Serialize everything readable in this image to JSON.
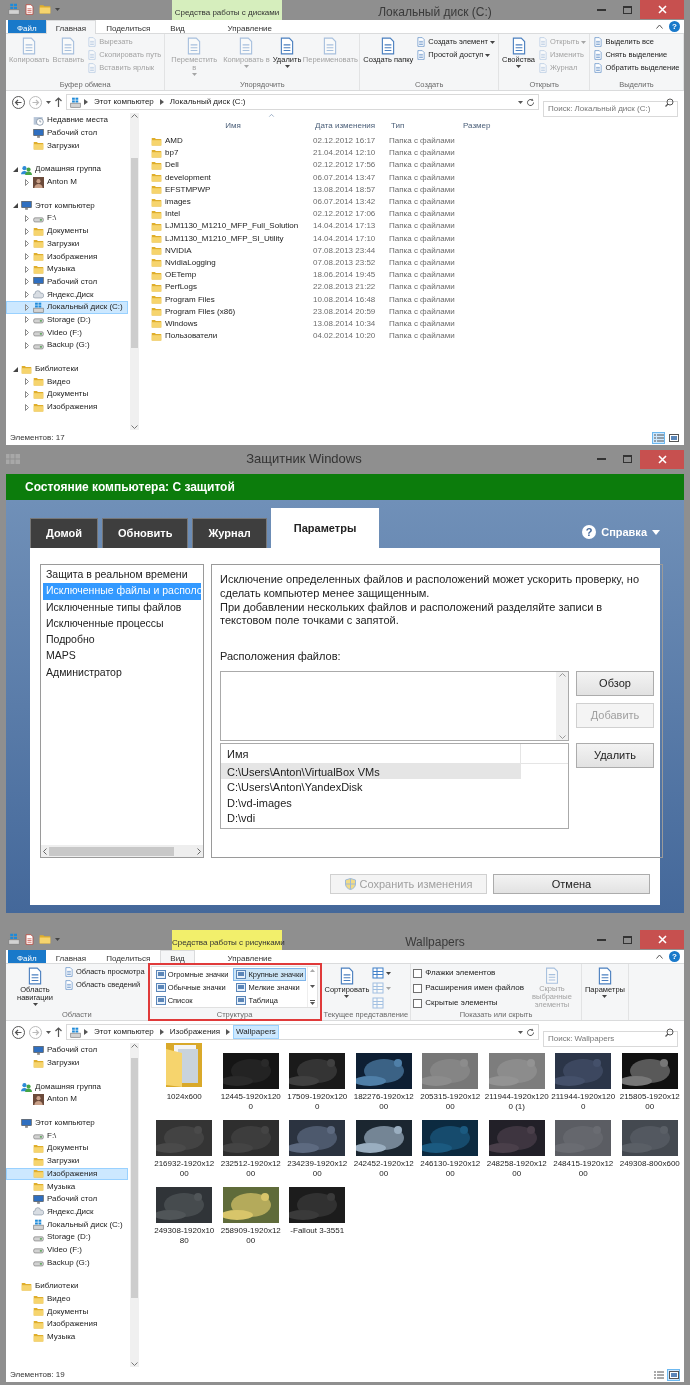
{
  "explorer_disk": {
    "title": "Локальный диск (C:)",
    "contextual": {
      "label": "Средства работы с дисками",
      "kind": "disk"
    },
    "help_icon": "?",
    "tabs": [
      {
        "label": "Файл",
        "kind": "file",
        "selected": false
      },
      {
        "label": "Главная",
        "kind": "tab",
        "selected": true
      },
      {
        "label": "Поделиться",
        "kind": "tab",
        "selected": false
      },
      {
        "label": "Вид",
        "kind": "tab",
        "selected": false
      },
      {
        "label": "Управление",
        "kind": "contextual",
        "selected": false
      }
    ],
    "ribbon_groups": [
      {
        "label": "Буфер обмена",
        "items": [
          {
            "label": "Копировать",
            "kind": "large",
            "disabled": true,
            "dropdown": false
          },
          {
            "label": "Вставить",
            "kind": "large",
            "disabled": true,
            "dropdown": false
          },
          {
            "label": "Вырезать",
            "kind": "small",
            "disabled": true,
            "dropdown": false
          },
          {
            "label": "Скопировать путь",
            "kind": "small",
            "disabled": true,
            "dropdown": false
          },
          {
            "label": "Вставить ярлык",
            "kind": "small",
            "disabled": true,
            "dropdown": false
          }
        ]
      },
      {
        "label": "Упорядочить",
        "items": [
          {
            "label": "Переместить в",
            "kind": "large",
            "disabled": true,
            "dropdown": true
          },
          {
            "label": "Копировать в",
            "kind": "large",
            "disabled": true,
            "dropdown": true
          },
          {
            "label": "Удалить",
            "kind": "large",
            "disabled": false,
            "dropdown": true
          },
          {
            "label": "Переименовать",
            "kind": "large",
            "disabled": true,
            "dropdown": false
          }
        ]
      },
      {
        "label": "Создать",
        "items": [
          {
            "label": "Создать папку",
            "kind": "large",
            "disabled": false,
            "dropdown": false
          },
          {
            "label": "Создать элемент",
            "kind": "small",
            "disabled": false,
            "dropdown": true
          },
          {
            "label": "Простой доступ",
            "kind": "small",
            "disabled": false,
            "dropdown": true
          }
        ]
      },
      {
        "label": "Открыть",
        "items": [
          {
            "label": "Свойства",
            "kind": "large",
            "disabled": false,
            "dropdown": true
          },
          {
            "label": "Открыть",
            "kind": "small",
            "disabled": true,
            "dropdown": true
          },
          {
            "label": "Изменить",
            "kind": "small",
            "disabled": true,
            "dropdown": false
          },
          {
            "label": "Журнал",
            "kind": "small",
            "disabled": true,
            "dropdown": false
          }
        ]
      },
      {
        "label": "Выделить",
        "items": [
          {
            "label": "Выделить все",
            "kind": "small",
            "disabled": false,
            "dropdown": false
          },
          {
            "label": "Снять выделение",
            "kind": "small",
            "disabled": false,
            "dropdown": false
          },
          {
            "label": "Обратить выделение",
            "kind": "small",
            "disabled": false,
            "dropdown": false
          }
        ]
      }
    ],
    "address": {
      "crumbs": [
        {
          "label": "Этот компьютер",
          "highlighted": false
        },
        {
          "label": "Локальный диск (C:)",
          "highlighted": false
        }
      ],
      "search_placeholder": "Поиск: Локальный диск (C:)"
    },
    "sidebar": [
      {
        "label": "Недавние места",
        "kind": "recent",
        "selected": false
      },
      {
        "label": "Рабочий стол",
        "kind": "desktop",
        "selected": false
      },
      {
        "label": "Загрузки",
        "kind": "folder",
        "selected": false
      },
      {
        "label": "Домашняя группа",
        "kind": "group",
        "selected": false,
        "expanded": true,
        "children": [
          {
            "label": "Anton M",
            "kind": "person",
            "selected": false,
            "expanded": false
          }
        ]
      },
      {
        "label": "Этот компьютер",
        "kind": "computer",
        "selected": false,
        "expanded": true,
        "children": [
          {
            "label": "F:\\",
            "kind": "drive",
            "selected": false,
            "expanded": false
          },
          {
            "label": "Документы",
            "kind": "folder",
            "selected": false,
            "expanded": false
          },
          {
            "label": "Загрузки",
            "kind": "folder",
            "selected": false,
            "expanded": false
          },
          {
            "label": "Изображения",
            "kind": "folder",
            "selected": false,
            "expanded": false
          },
          {
            "label": "Музыка",
            "kind": "folder",
            "selected": false,
            "expanded": false
          },
          {
            "label": "Рабочий стол",
            "kind": "desktop",
            "selected": false,
            "expanded": false
          },
          {
            "label": "Яндекс.Диск",
            "kind": "cloud",
            "selected": false,
            "expanded": false
          },
          {
            "label": "Локальный диск (C:)",
            "kind": "system",
            "selected": true,
            "expanded": false
          },
          {
            "label": "Storage (D:)",
            "kind": "drive",
            "selected": false,
            "expanded": false
          },
          {
            "label": "Video (F:)",
            "kind": "drive",
            "selected": false,
            "expanded": false
          },
          {
            "label": "Backup (G:)",
            "kind": "drive",
            "selected": false,
            "expanded": false
          }
        ]
      },
      {
        "label": "Библиотеки",
        "kind": "library",
        "selected": false,
        "expanded": true,
        "children": [
          {
            "label": "Видео",
            "kind": "folder",
            "selected": false,
            "expanded": false
          },
          {
            "label": "Документы",
            "kind": "folder",
            "selected": false,
            "expanded": false
          },
          {
            "label": "Изображения",
            "kind": "folder",
            "selected": false,
            "expanded": false
          }
        ]
      }
    ],
    "main": {
      "kind": "details",
      "columns": [
        {
          "label": "Имя",
          "sorted": true
        },
        {
          "label": "Дата изменения",
          "sorted": false
        },
        {
          "label": "Тип",
          "sorted": false
        },
        {
          "label": "Размер",
          "sorted": false
        }
      ],
      "rows": [
        {
          "name": "AMD",
          "date": "02.12.2012 16:17",
          "type": "Папка с файлами"
        },
        {
          "name": "bp7",
          "date": "21.04.2014 12:10",
          "type": "Папка с файлами"
        },
        {
          "name": "Dell",
          "date": "02.12.2012 17:56",
          "type": "Папка с файлами"
        },
        {
          "name": "development",
          "date": "06.07.2014 13:47",
          "type": "Папка с файлами"
        },
        {
          "name": "EFSTMPWP",
          "date": "13.08.2014 18:57",
          "type": "Папка с файлами"
        },
        {
          "name": "images",
          "date": "06.07.2014 13:42",
          "type": "Папка с файлами"
        },
        {
          "name": "Intel",
          "date": "02.12.2012 17:06",
          "type": "Папка с файлами"
        },
        {
          "name": "LJM1130_M1210_MFP_Full_Solution",
          "date": "14.04.2014 17:13",
          "type": "Папка с файлами"
        },
        {
          "name": "LJM1130_M1210_MFP_SI_Utility",
          "date": "14.04.2014 17:10",
          "type": "Папка с файлами"
        },
        {
          "name": "NVIDIA",
          "date": "07.08.2013 23:44",
          "type": "Папка с файлами"
        },
        {
          "name": "NvidiaLogging",
          "date": "07.08.2013 23:52",
          "type": "Папка с файлами"
        },
        {
          "name": "OETemp",
          "date": "18.06.2014 19:45",
          "type": "Папка с файлами"
        },
        {
          "name": "PerfLogs",
          "date": "22.08.2013 21:22",
          "type": "Папка с файлами"
        },
        {
          "name": "Program Files",
          "date": "10.08.2014 16:48",
          "type": "Папка с файлами"
        },
        {
          "name": "Program Files (x86)",
          "date": "23.08.2014 20:59",
          "type": "Папка с файлами"
        },
        {
          "name": "Windows",
          "date": "13.08.2014 10:34",
          "type": "Папка с файлами"
        },
        {
          "name": "Пользователи",
          "date": "04.02.2014 10:20",
          "type": "Папка с файлами"
        }
      ]
    },
    "status": "Элементов: 17",
    "view_buttons": [
      {
        "kind": "details",
        "selected": true
      },
      {
        "kind": "large_icons",
        "selected": false
      }
    ]
  },
  "defender": {
    "title": "Защитник Windows",
    "status": "Состояние компьютера: С защитой",
    "tabs": [
      {
        "label": "Домой",
        "selected": false
      },
      {
        "label": "Обновить",
        "selected": false
      },
      {
        "label": "Журнал",
        "selected": false
      },
      {
        "label": "Параметры",
        "selected": true
      }
    ],
    "help": {
      "icon": "?",
      "label": "Справка"
    },
    "settings_list": [
      {
        "label": "Защита в реальном времени",
        "selected": false
      },
      {
        "label": "Исключенные файлы и располо",
        "selected": true
      },
      {
        "label": "Исключенные типы файлов",
        "selected": false
      },
      {
        "label": "Исключенные процессы",
        "selected": false
      },
      {
        "label": "Подробно",
        "selected": false
      },
      {
        "label": "MAPS",
        "selected": false
      },
      {
        "label": "Администратор",
        "selected": false
      }
    ],
    "description": [
      "Исключение определенных файлов и расположений может ускорить проверку, но сделать компьютер менее защищенным.",
      "При добавлении нескольких файлов и расположений разделяйте записи в текстовом поле точками с запятой."
    ],
    "locations_label": "Расположения файлов:",
    "side_buttons": [
      {
        "label": "Обзор",
        "disabled": false
      },
      {
        "label": "Добавить",
        "disabled": true
      }
    ],
    "list": {
      "column": "Имя",
      "rows": [
        {
          "label": "C:\\Users\\Anton\\VirtualBox VMs",
          "selected": true
        },
        {
          "label": "C:\\Users\\Anton\\YandexDisk",
          "selected": false
        },
        {
          "label": "D:\\vd-images",
          "selected": false
        },
        {
          "label": "D:\\vdi",
          "selected": false
        }
      ]
    },
    "remove_button": {
      "label": "Удалить",
      "disabled": false
    },
    "footer_buttons": [
      {
        "label": "Сохранить изменения",
        "kind": "shield",
        "disabled": true
      },
      {
        "label": "Отмена",
        "kind": "plain",
        "disabled": false
      }
    ]
  },
  "explorer_pictures": {
    "title": "Wallpapers",
    "contextual": {
      "label": "Средства работы с рисунками",
      "kind": "picture"
    },
    "help_icon": "?",
    "tabs": [
      {
        "label": "Файл",
        "kind": "file",
        "selected": false
      },
      {
        "label": "Главная",
        "kind": "tab",
        "selected": false
      },
      {
        "label": "Поделиться",
        "kind": "tab",
        "selected": false
      },
      {
        "label": "Вид",
        "kind": "tab",
        "selected": true
      },
      {
        "label": "Управление",
        "kind": "contextual",
        "selected": false
      }
    ],
    "ribbon_groups": [
      {
        "label": "Области",
        "highlighted": false,
        "items": [
          {
            "label": "Область навигации",
            "kind": "large",
            "disabled": false,
            "dropdown": true
          },
          {
            "label": "Область просмотра",
            "kind": "small",
            "disabled": false,
            "dropdown": false
          },
          {
            "label": "Область сведений",
            "kind": "small",
            "disabled": false,
            "dropdown": false
          }
        ]
      },
      {
        "label": "Структура",
        "highlighted": true,
        "items": [
          {
            "kind": "gallery",
            "options": [
              {
                "label": "Огромные значки",
                "selected": false
              },
              {
                "label": "Крупные значки",
                "selected": true
              },
              {
                "label": "Обычные значки",
                "selected": false
              },
              {
                "label": "Мелкие значки",
                "selected": false
              },
              {
                "label": "Список",
                "selected": false
              },
              {
                "label": "Таблица",
                "selected": false
              }
            ]
          }
        ]
      },
      {
        "label": "Текущее представление",
        "highlighted": false,
        "items": [
          {
            "label": "Сортировать",
            "kind": "large",
            "disabled": false,
            "dropdown": true
          },
          {
            "kind": "icon",
            "disabled": false,
            "dropdown": true
          },
          {
            "kind": "icon",
            "disabled": true,
            "dropdown": true
          },
          {
            "kind": "icon",
            "disabled": true,
            "dropdown": false
          }
        ]
      },
      {
        "label": "Показать или скрыть",
        "highlighted": false,
        "items": [
          {
            "label": "Флажки элементов",
            "kind": "check",
            "checked": false
          },
          {
            "label": "Расширения имен файлов",
            "kind": "check",
            "checked": false
          },
          {
            "label": "Скрытые элементы",
            "kind": "check",
            "checked": false
          },
          {
            "label": "Скрыть выбранные элементы",
            "kind": "large",
            "disabled": true,
            "dropdown": false
          }
        ]
      },
      {
        "highlighted": false,
        "items": [
          {
            "label": "Параметры",
            "kind": "large",
            "disabled": false,
            "dropdown": true
          }
        ]
      }
    ],
    "address": {
      "crumbs": [
        {
          "label": "Этот компьютер",
          "highlighted": false
        },
        {
          "label": "Изображения",
          "highlighted": false
        },
        {
          "label": "Wallpapers",
          "highlighted": true
        }
      ],
      "search_placeholder": "Поиск: Wallpapers"
    },
    "sidebar": [
      {
        "label": "Рабочий стол",
        "kind": "desktop",
        "selected": false
      },
      {
        "label": "Загрузки",
        "kind": "folder",
        "selected": false
      },
      {
        "label": "Домашняя группа",
        "kind": "group",
        "selected": false,
        "children": [
          {
            "label": "Anton M",
            "kind": "person",
            "selected": false
          }
        ]
      },
      {
        "label": "Этот компьютер",
        "kind": "computer",
        "selected": false,
        "children": [
          {
            "label": "F:\\",
            "kind": "drive",
            "selected": false
          },
          {
            "label": "Документы",
            "kind": "folder",
            "selected": false
          },
          {
            "label": "Загрузки",
            "kind": "folder",
            "selected": false
          },
          {
            "label": "Изображения",
            "kind": "folder",
            "selected": true
          },
          {
            "label": "Музыка",
            "kind": "folder",
            "selected": false
          },
          {
            "label": "Рабочий стол",
            "kind": "desktop",
            "selected": false
          },
          {
            "label": "Яндекс.Диск",
            "kind": "cloud",
            "selected": false
          },
          {
            "label": "Локальный диск (C:)",
            "kind": "system",
            "selected": false
          },
          {
            "label": "Storage (D:)",
            "kind": "drive",
            "selected": false
          },
          {
            "label": "Video (F:)",
            "kind": "drive",
            "selected": false
          },
          {
            "label": "Backup (G:)",
            "kind": "drive",
            "selected": false
          }
        ]
      },
      {
        "label": "Библиотеки",
        "kind": "library",
        "selected": false,
        "children": [
          {
            "label": "Видео",
            "kind": "folder",
            "selected": false
          },
          {
            "label": "Документы",
            "kind": "folder",
            "selected": false
          },
          {
            "label": "Изображения",
            "kind": "folder",
            "selected": false
          },
          {
            "label": "Музыка",
            "kind": "folder",
            "selected": false
          }
        ]
      }
    ],
    "main": {
      "kind": "thumbnails",
      "items": [
        {
          "label": "1024x600",
          "kind": "folder"
        },
        {
          "label": "12445-1920x1200",
          "kind": "picture"
        },
        {
          "label": "17509-1920x1200",
          "kind": "picture"
        },
        {
          "label": "182276-1920x1200",
          "kind": "picture"
        },
        {
          "label": "205315-1920x1200",
          "kind": "picture"
        },
        {
          "label": "211944-1920x1200 (1)",
          "kind": "picture"
        },
        {
          "label": "211944-1920x1200",
          "kind": "picture"
        },
        {
          "label": "215805-1920x1200",
          "kind": "picture"
        },
        {
          "label": "216932-1920x1200",
          "kind": "picture"
        },
        {
          "label": "232512-1920x1200",
          "kind": "picture"
        },
        {
          "label": "234239-1920x1200",
          "kind": "picture"
        },
        {
          "label": "242452-1920x1200",
          "kind": "picture"
        },
        {
          "label": "246130-1920x1200",
          "kind": "picture"
        },
        {
          "label": "248258-1920x1200",
          "kind": "picture"
        },
        {
          "label": "248415-1920x1200",
          "kind": "picture"
        },
        {
          "label": "249308-800x600",
          "kind": "picture"
        },
        {
          "label": "249308-1920x1080",
          "kind": "picture"
        },
        {
          "label": "258909-1920x1200",
          "kind": "picture"
        },
        {
          "label": "-Fallout 3-3551",
          "kind": "picture"
        }
      ]
    },
    "status": "Элементов: 19",
    "view_buttons": [
      {
        "kind": "details",
        "selected": false
      },
      {
        "kind": "large_icons",
        "selected": true
      }
    ]
  }
}
